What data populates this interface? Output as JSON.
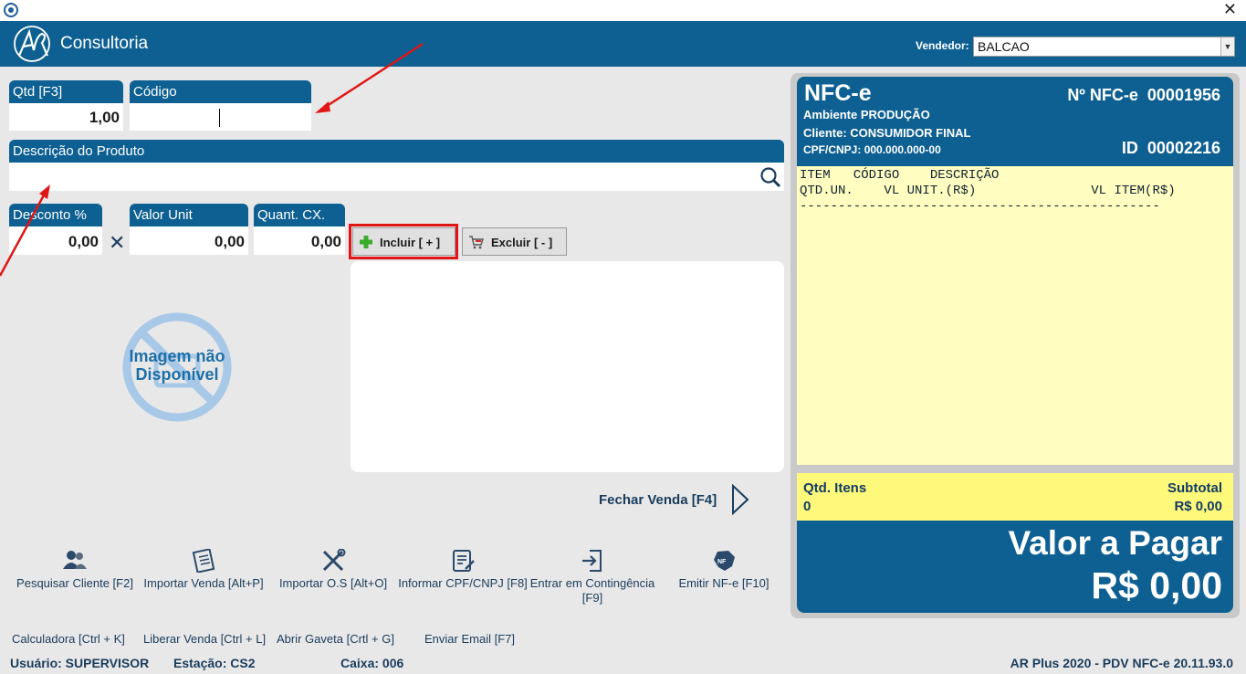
{
  "header": {
    "brand": "Consultoria",
    "vendedor_label": "Vendedor:",
    "vendedor_value": "BALCAO"
  },
  "fields": {
    "qtd_label": "Qtd [F3]",
    "qtd_value": "1,00",
    "codigo_label": "Código",
    "codigo_value": "",
    "descricao_label": "Descrição do Produto",
    "descricao_value": "",
    "desconto_label": "Desconto %",
    "desconto_value": "0,00",
    "valor_unit_label": "Valor Unit",
    "valor_unit_value": "0,00",
    "quant_cx_label": "Quant. CX.",
    "quant_cx_value": "0,00"
  },
  "buttons": {
    "incluir": "Incluir [ + ]",
    "excluir": "Excluir [ - ]",
    "fechar": "Fechar Venda [F4]"
  },
  "no_image": {
    "line1": "Imagem não",
    "line2": "Disponível"
  },
  "actions": [
    {
      "label": "Pesquisar Cliente [F2]",
      "icon": "users-icon"
    },
    {
      "label": "Importar Venda [Alt+P]",
      "icon": "document-import-icon"
    },
    {
      "label": "Importar O.S [Alt+O]",
      "icon": "tools-icon"
    },
    {
      "label": "Informar CPF/CNPJ [F8]",
      "icon": "form-edit-icon"
    },
    {
      "label": "Entrar em Contingência [F9]",
      "icon": "login-icon"
    },
    {
      "label": "Emitir NF-e [F10]",
      "icon": "nfe-brazil-icon"
    }
  ],
  "shortcuts": [
    "Calculadora [Ctrl + K]",
    "Liberar Venda [Ctrl + L]",
    "Abrir Gaveta [Crtl + G]",
    "Enviar Email [F7]"
  ],
  "status": {
    "usuario": "Usuário: SUPERVISOR",
    "estacao": "Estação: CS2",
    "caixa": "Caixa: 006",
    "version": "AR Plus 2020 - PDV NFC-e 20.11.93.0"
  },
  "nfce": {
    "title": "NFC-e",
    "num_label": "Nº NFC-e",
    "num_value": "00001956",
    "ambiente": "Ambiente PRODUÇÃO",
    "cliente_label": "Cliente:",
    "cliente_value": "CONSUMIDOR FINAL",
    "cpf_label": "CPF/CNPJ:",
    "cpf_value": "000.000.000-00",
    "id_label": "ID",
    "id_value": "00002216",
    "receipt_line1": "ITEM   CÓDIGO    DESCRIÇÃO",
    "receipt_line2": "QTD.UN.    VL UNIT.(R$)               VL ITEM(R$)",
    "receipt_line3": "-----------------------------------------------",
    "qtd_itens_label": "Qtd. Itens",
    "qtd_itens_value": "0",
    "subtotal_label": "Subtotal",
    "subtotal_value": "R$ 0,00",
    "valor_label": "Valor a Pagar",
    "valor_value": "R$ 0,00"
  },
  "colors": {
    "primary": "#0e6092",
    "receipt_bg": "#fffdc0",
    "totals_bg": "#fff97b",
    "highlight": "#e01515"
  }
}
